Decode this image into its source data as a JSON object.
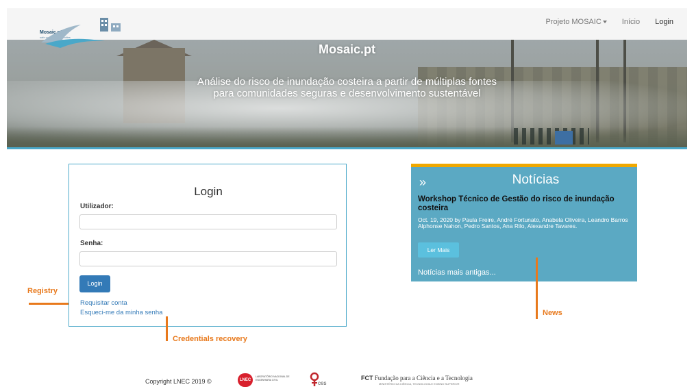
{
  "nav": {
    "items": [
      "Projeto MOSAIC",
      "Início",
      "Login"
    ]
  },
  "logo": {
    "name": "Mosaic.pt",
    "tagline": "safe coastal communities"
  },
  "hero": {
    "title": "Mosaic.pt",
    "subtitle_line1": "Análise do risco de inundação costeira a partir de múltiplas fontes",
    "subtitle_line2": "para comunidades seguras e desenvolvimento sustentável"
  },
  "login": {
    "title": "Login",
    "user_label": "Utilizador:",
    "user_value": "",
    "password_label": "Senha:",
    "password_value": "",
    "submit_label": "Login",
    "request_account": "Requisitar conta",
    "forgot_password": "Esqueci-me da minha senha"
  },
  "news": {
    "chevron": "»",
    "title": "Notícias",
    "headline": "Workshop Técnico de Gestão do risco de inundação costeira",
    "meta": "Oct. 19, 2020 by Paula Freire, André Fortunato, Anabela Oliveira, Leandro Barros Alphonse Nahon, Pedro Santos, Ana Rilo, Alexandre Tavares.",
    "read_more": "Ler Mais",
    "older": "Notícias mais antigas..."
  },
  "annotations": {
    "registry": "Registry",
    "credentials": "Credentials recovery",
    "news": "News"
  },
  "footer": {
    "copyright": "Copyright LNEC 2019 ©",
    "lnec_mark": "LNEC",
    "lnec_name": "LABORATÓRIO NACIONAL DE ENGENHARIA CIVIL",
    "ces": "ces",
    "fct_abbr": "FCT",
    "fct_name": "Fundação para a Ciência e a Tecnologia",
    "fct_sub": "MINISTÉRIO DA CIÊNCIA, TECNOLOGIA E ENSINO SUPERIOR"
  },
  "colors": {
    "accent": "#4aa8c9",
    "news_bg": "#5ba9c3",
    "news_top": "#f0a800",
    "annotation": "#e8791c",
    "primary_button": "#337ab7"
  }
}
